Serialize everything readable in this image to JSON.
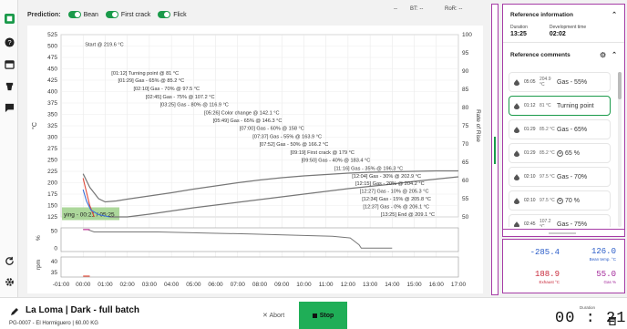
{
  "prediction": {
    "label": "Prediction:",
    "toggles": [
      {
        "label": "Bean",
        "on": true
      },
      {
        "label": "First crack",
        "on": true
      },
      {
        "label": "Flick",
        "on": true
      }
    ],
    "readouts": {
      "blank": "--",
      "bt": "BT: --",
      "ror": "RoR: --"
    }
  },
  "chart_data": {
    "type": "line",
    "title": "",
    "xlabel": "",
    "ylabel": "°C",
    "y2label": "Rate of Rise",
    "x_ticks": [
      "-01:00",
      "00:00",
      "01:00",
      "02:00",
      "03:00",
      "04:00",
      "05:00",
      "06:00",
      "07:00",
      "08:00",
      "09:00",
      "10:00",
      "11:00",
      "12:00",
      "13:00",
      "14:00",
      "15:00",
      "16:00",
      "17:00"
    ],
    "xlim": [
      -1,
      17
    ],
    "ylim": [
      125,
      525
    ],
    "y_ticks": [
      "525",
      "500",
      "475",
      "450",
      "425",
      "400",
      "375",
      "350",
      "325",
      "300",
      "275",
      "250",
      "225",
      "200",
      "175",
      "150",
      "125"
    ],
    "y2lim": [
      50,
      100
    ],
    "y2_ticks": [
      "100",
      "95",
      "90",
      "85",
      "80",
      "75",
      "70",
      "65",
      "60",
      "55",
      "50"
    ],
    "grid": true,
    "series": [
      {
        "color": "#777777",
        "x": [
          0,
          0.3,
          0.7,
          1.0,
          1.5,
          2.0,
          3.0,
          4.0,
          5.0,
          6.0,
          7.0,
          8.0,
          9.0,
          10.0,
          11.0,
          12.0,
          13.0,
          14.0,
          15.0,
          16.0,
          17.0
        ],
        "y": [
          219.6,
          190,
          165,
          158,
          160,
          164,
          171,
          178,
          186,
          193,
          200,
          206,
          211,
          215,
          218,
          221,
          223,
          224,
          225,
          226,
          226
        ]
      },
      {
        "color": "#777777",
        "x": [
          1.2,
          2.0,
          3.0,
          4.0,
          5.0,
          6.0,
          7.0,
          8.0,
          9.0,
          10.0,
          11.0,
          12.0,
          13.0,
          14.0,
          15.0,
          16.0,
          17.0
        ],
        "y": [
          118,
          124,
          131,
          138,
          145,
          151,
          157,
          163,
          169,
          175,
          181,
          187,
          192,
          197,
          203,
          208,
          213
        ]
      },
      {
        "color": "#e04a3a",
        "x": [
          0,
          0.1,
          0.3,
          0.5
        ],
        "y": [
          210,
          190,
          150,
          125
        ]
      },
      {
        "color": "#3a6fd8",
        "x": [
          0,
          0.15,
          0.35,
          0.7,
          1.2
        ],
        "y": [
          185,
          160,
          140,
          130,
          125
        ]
      }
    ],
    "annotations": [
      {
        "x": 0,
        "y": 500,
        "text": "Start @ 219.6 °C"
      },
      {
        "x": 1.2,
        "y": 437,
        "text": "[01:12] Turning point @ 81 °C"
      },
      {
        "x": 1.5,
        "y": 421,
        "text": "[01:29] Gas - 65% @ 85.2 °C"
      },
      {
        "x": 2.2,
        "y": 403,
        "text": "[02:10] Gas - 70% @ 97.5 °C"
      },
      {
        "x": 2.75,
        "y": 385,
        "text": "[02:45] Gas - 75% @ 107.2 °C"
      },
      {
        "x": 3.4,
        "y": 368,
        "text": "[03:25] Gas - 80% @ 116.9 °C"
      },
      {
        "x": 5.4,
        "y": 350,
        "text": "[05:26] Color change @ 142.1 °C"
      },
      {
        "x": 5.8,
        "y": 333,
        "text": "[05:49] Gas - 65% @ 146.3 °C"
      },
      {
        "x": 7.0,
        "y": 316,
        "text": "[07:00] Gas - 60% @ 158 °C"
      },
      {
        "x": 7.6,
        "y": 298,
        "text": "[07:37] Gas - 55% @ 163.9 °C"
      },
      {
        "x": 7.9,
        "y": 281,
        "text": "[07:52] Gas - 50% @ 166.2 °C"
      },
      {
        "x": 9.3,
        "y": 263,
        "text": "[09:19] First crack @ 179 °C"
      },
      {
        "x": 9.8,
        "y": 246,
        "text": "[09:50] Gas - 40% @ 183.4 °C"
      },
      {
        "x": 11.3,
        "y": 228,
        "text": "[11:16] Gas - 35% @ 196.3 °C"
      },
      {
        "x": 12.1,
        "y": 211,
        "text": "[12:04] Gas - 30% @ 202.9 °C"
      },
      {
        "x": 12.25,
        "y": 195,
        "text": "[12:15] Gas - 20% @ 204.2 °C"
      },
      {
        "x": 12.45,
        "y": 178,
        "text": "[12:27] Gas - 10% @ 205.3 °C"
      },
      {
        "x": 12.55,
        "y": 161,
        "text": "[12:34] Gas - 15% @ 205.8 °C"
      },
      {
        "x": 12.6,
        "y": 144,
        "text": "[12:37] Gas - 0% @ 206.1 °C"
      },
      {
        "x": 13.4,
        "y": 127,
        "text": "[13:25] End @ 209.1 °C"
      }
    ],
    "drying_label": "ying - 00:21 / 05:25",
    "sub_charts": [
      {
        "ylabel": "%",
        "y_ticks": [
          "50",
          "0"
        ],
        "ylim": [
          -10,
          60
        ]
      },
      {
        "ylabel": "rpm",
        "y_ticks": [
          "40",
          "35"
        ],
        "ylim": [
          33,
          42
        ]
      }
    ]
  },
  "reference": {
    "title": "Reference information",
    "duration_label": "Duration",
    "duration": "13:25",
    "devtime_label": "Development time",
    "devtime": "02:02",
    "comments_title": "Reference comments",
    "comments": [
      {
        "time": "05:05",
        "temp": "204.9 °C",
        "label": "Gas - 55%",
        "kind": "text",
        "selected": false
      },
      {
        "time": "01:12",
        "temp": "81 °C",
        "label": "Turning point",
        "kind": "text",
        "selected": true
      },
      {
        "time": "01:29",
        "temp": "85.2 °C",
        "label": "Gas - 65%",
        "kind": "text",
        "selected": false
      },
      {
        "time": "01:29",
        "temp": "85.2 °C",
        "label": "65 %",
        "kind": "circle",
        "circle": "G",
        "selected": false
      },
      {
        "time": "02:10",
        "temp": "97.5 °C",
        "label": "Gas - 70%",
        "kind": "text",
        "selected": false
      },
      {
        "time": "02:10",
        "temp": "97.5 °C",
        "label": "70 %",
        "kind": "circle",
        "circle": "G",
        "selected": false
      },
      {
        "time": "02:45",
        "temp": "107.2 °C",
        "label": "Gas - 75%",
        "kind": "text",
        "selected": false
      }
    ]
  },
  "stats": {
    "bean_temp": {
      "value": "126.0",
      "label": "Bean temp. °C",
      "color": "#2a5cc8"
    },
    "ror": {
      "value": "-285.4",
      "color": "#2a5cc8"
    },
    "exhaust": {
      "value": "188.9",
      "label": "Exhaust °C",
      "color": "#c8283a"
    },
    "gas": {
      "value": "55.0",
      "label": "Gas %",
      "color": "#a3289a"
    }
  },
  "bottom": {
    "title": "La Loma | Dark - full batch",
    "subtitle": "PG-0007 - El Hormiguero | 60.00 KG",
    "abort": "Abort",
    "stop": "Stop",
    "duration_label": "Duration",
    "duration": "00 : 21"
  }
}
